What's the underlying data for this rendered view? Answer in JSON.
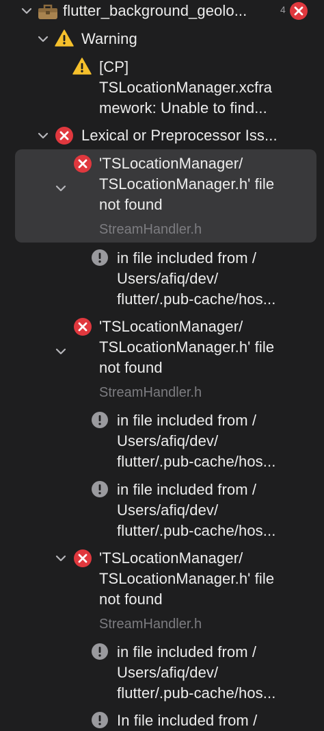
{
  "colors": {
    "background": "#1e1e1f",
    "selection": "#39393b",
    "error_red": "#e0383e",
    "warning_yellow": "#f5c02c",
    "note_gray": "#9a9a9e",
    "text": "#ededed",
    "secondary_text": "#7c7c80"
  },
  "project": {
    "name": "flutter_background_geolo...",
    "count_fragment": "4",
    "icon": "toolbox-icon",
    "status_icon": "error-icon"
  },
  "warning_group": {
    "title": "Warning",
    "issue": {
      "lines": [
        "[CP]",
        "TSLocationManager.xcfra",
        "mework: Unable to find..."
      ]
    }
  },
  "lexical_group": {
    "title": "Lexical or Preprocessor Iss...",
    "issues": [
      {
        "lines": [
          "'TSLocationManager/",
          "TSLocationManager.h' file",
          "not found"
        ],
        "file": "StreamHandler.h",
        "notes": [
          {
            "lines": [
              "in file included from /",
              "Users/afiq/dev/",
              "flutter/.pub-cache/hos..."
            ]
          }
        ]
      },
      {
        "lines": [
          "'TSLocationManager/",
          "TSLocationManager.h' file",
          "not found"
        ],
        "file": "StreamHandler.h",
        "notes": [
          {
            "lines": [
              "in file included from /",
              "Users/afiq/dev/",
              "flutter/.pub-cache/hos..."
            ]
          },
          {
            "lines": [
              "in file included from /",
              "Users/afiq/dev/",
              "flutter/.pub-cache/hos..."
            ]
          }
        ]
      },
      {
        "lines": [
          "'TSLocationManager/",
          "TSLocationManager.h' file",
          "not found"
        ],
        "file": "StreamHandler.h",
        "notes": [
          {
            "lines": [
              "in file included from /",
              "Users/afiq/dev/",
              "flutter/.pub-cache/hos..."
            ]
          },
          {
            "lines": [
              "In file included from /"
            ]
          }
        ]
      }
    ]
  }
}
